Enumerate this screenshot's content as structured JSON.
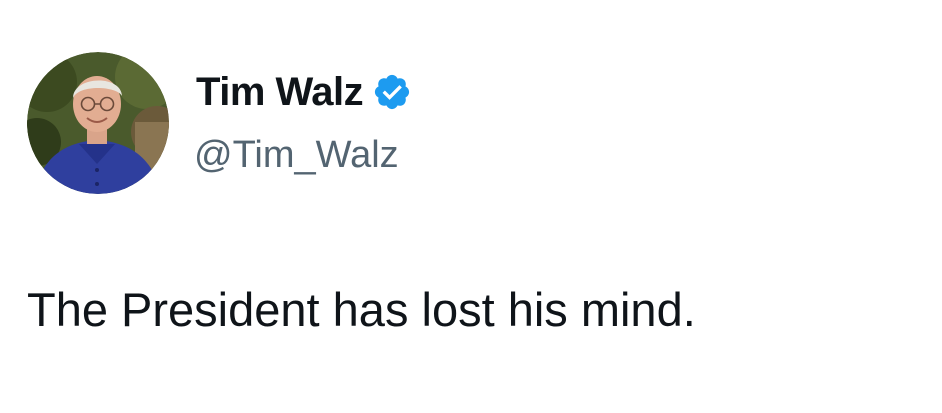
{
  "author": {
    "display_name": "Tim Walz",
    "handle": "@Tim_Walz",
    "avatar_icon": "profile-photo",
    "verified_icon": "verified-badge-icon",
    "verified_color": "#1d9bf0"
  },
  "post": {
    "text": "The President has lost his mind."
  },
  "colors": {
    "name": "#0f1419",
    "handle": "#536471",
    "background": "#ffffff"
  }
}
